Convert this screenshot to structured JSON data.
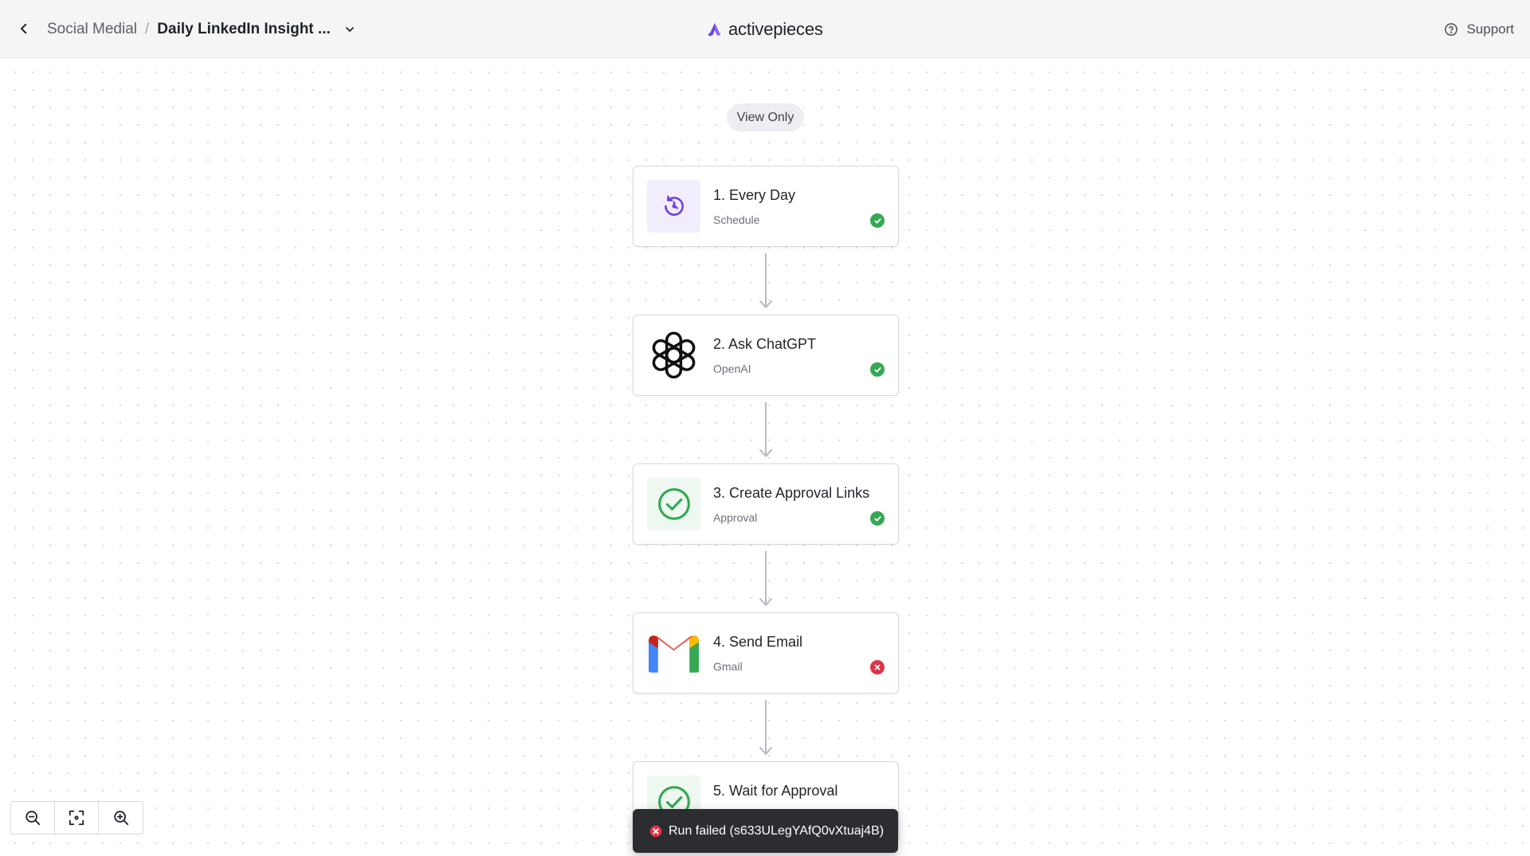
{
  "header": {
    "back_label": "",
    "breadcrumb": {
      "folder": "Social Medial",
      "separator": "/",
      "flow_name": "Daily LinkedIn Insight ..."
    },
    "brand_name": "activepieces",
    "support_label": "Support"
  },
  "canvas": {
    "view_only_label": "View Only",
    "steps": [
      {
        "title": "1. Every Day",
        "subtitle": "Schedule",
        "status": "success",
        "icon": "schedule-icon"
      },
      {
        "title": "2. Ask ChatGPT",
        "subtitle": "OpenAI",
        "status": "success",
        "icon": "openai-icon"
      },
      {
        "title": "3. Create Approval Links",
        "subtitle": "Approval",
        "status": "success",
        "icon": "approval-icon"
      },
      {
        "title": "4. Send Email",
        "subtitle": "Gmail",
        "status": "failed",
        "icon": "gmail-icon"
      },
      {
        "title": "5. Wait for Approval",
        "subtitle": "",
        "status": "unknown",
        "icon": "approval-icon"
      }
    ]
  },
  "zoom_controls": {
    "zoom_out_icon": "zoom-out-icon",
    "fit_view_icon": "fit-view-icon",
    "zoom_in_icon": "zoom-in-icon"
  },
  "toast": {
    "message": "Run failed (s633ULegYAfQ0vXtuaj4B)"
  },
  "colors": {
    "brand": "#6e41e2",
    "success": "#35a853",
    "error": "#dc3545",
    "toast_bg": "#2b2d31"
  }
}
